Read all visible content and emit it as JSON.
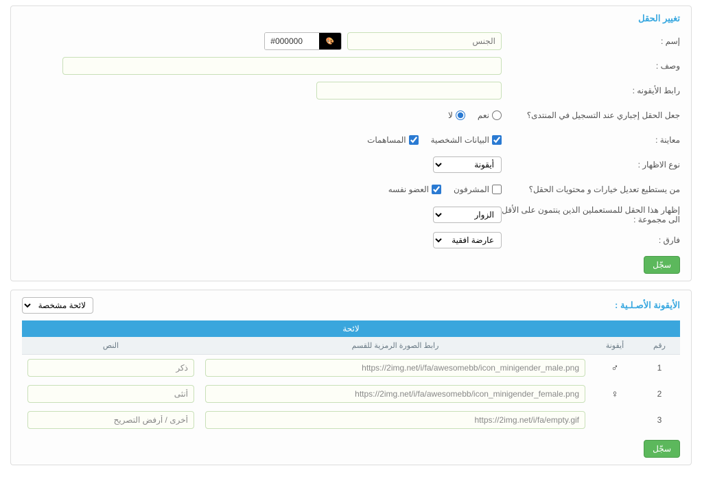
{
  "panel1": {
    "title": "تغيير الحقل",
    "labels": {
      "name": "إسم :",
      "desc": "وصف :",
      "icon_url": "رابط الأيقونه :",
      "required": "جعل الحقل إجباري عند التسجيل في المنتدى؟",
      "preview": "معاينة :",
      "display_type": "نوع الاظهار :",
      "who_can_edit": "من يستطيع تعديل خيارات و محتويات الحقل؟",
      "show_for_group": "إظهار هذا الحقل للمستعملين الذين ينتمون على الأقل الى مجموعة :",
      "separator": "فارق :"
    },
    "values": {
      "name": "الجنس",
      "color": "#000000",
      "desc": "",
      "icon_url": ""
    },
    "radios": {
      "yes": "نعم",
      "no": "لا",
      "selected": "no"
    },
    "checks_preview": {
      "personal_data": {
        "label": "البيانات الشخصية",
        "checked": true
      },
      "posts": {
        "label": "المساهمات",
        "checked": true
      }
    },
    "display_type_select": "أيقونة",
    "checks_edit": {
      "moderators": {
        "label": "المشرفون",
        "checked": false
      },
      "member_self": {
        "label": "العضو نفسه",
        "checked": true
      }
    },
    "group_select": "الزوار",
    "separator_select": "عارضة افقية",
    "save": "سجّل"
  },
  "panel2": {
    "title": "الأيقونة الأصـلـية :",
    "list_type_select": "لائحة مشخصة",
    "table": {
      "caption": "لائحة",
      "cols": {
        "num": "رقم",
        "icon": "أيقونة",
        "url": "رابط الصورة الرمزية للقسم",
        "text": "النص"
      },
      "rows": [
        {
          "num": "1",
          "icon": "♂",
          "url": "https://2img.net/i/fa/awesomebb/icon_minigender_male.png",
          "text": "ذكر"
        },
        {
          "num": "2",
          "icon": "♀",
          "url": "https://2img.net/i/fa/awesomebb/icon_minigender_female.png",
          "text": "أنثى"
        },
        {
          "num": "3",
          "icon": "",
          "url": "https://2img.net/i/fa/empty.gif",
          "text": "أخرى / أرفض التصريح"
        }
      ]
    },
    "save": "سجّل"
  }
}
